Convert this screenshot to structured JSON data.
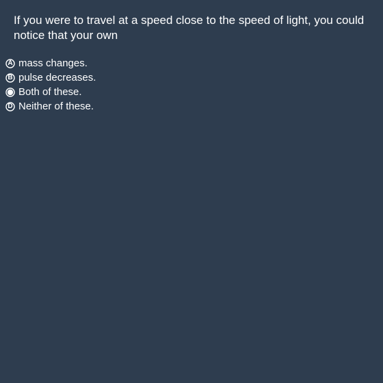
{
  "question": {
    "text": "If you were to travel at a speed close to the speed of light, you could notice that your own"
  },
  "options": [
    {
      "letter": "A",
      "label": "mass changes.",
      "selected": false
    },
    {
      "letter": "B",
      "label": "pulse decreases.",
      "selected": false
    },
    {
      "letter": "C",
      "label": "Both of these.",
      "selected": true
    },
    {
      "letter": "D",
      "label": "Neither of these.",
      "selected": false
    }
  ],
  "colors": {
    "background": "#2e3d4f",
    "text": "#ffffff"
  }
}
